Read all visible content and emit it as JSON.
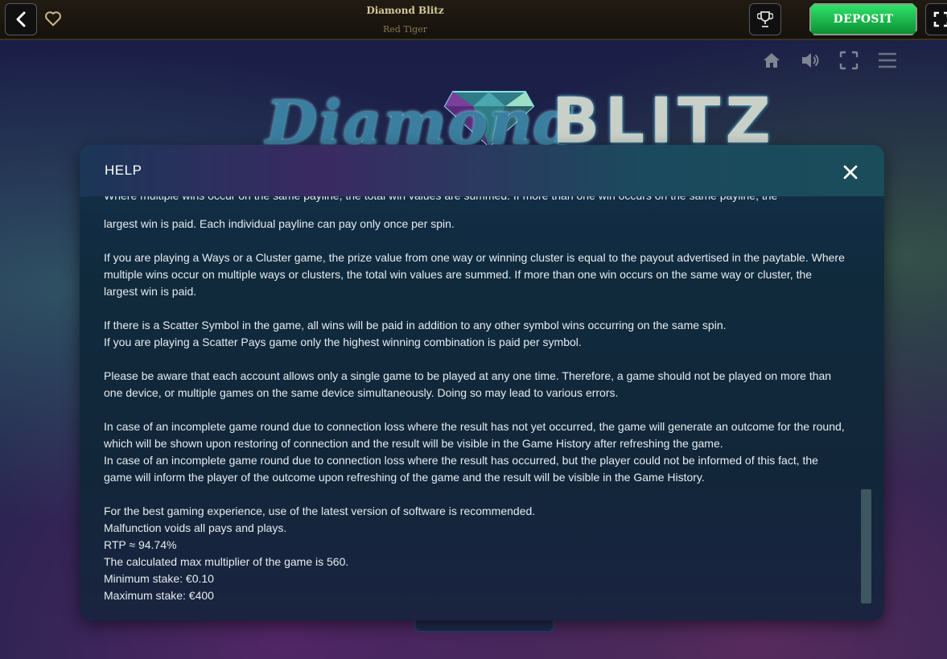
{
  "header": {
    "game_title": "Diamond Blitz",
    "provider": "Red Tiger",
    "deposit_label": "DEPOSIT"
  },
  "game": {
    "logo_left": "Diamond",
    "logo_right": "BLITZ"
  },
  "help": {
    "title": "HELP",
    "partial_line": "Where multiple wins occur on the same payline, the total win values are summed. If more than one win occurs on the same payline, the",
    "paragraphs": [
      [
        "largest win is paid. Each individual payline can pay only once per spin."
      ],
      [
        "If you are playing a Ways or a Cluster game, the prize value from one way or winning cluster is equal to the payout advertised in the paytable. Where",
        "multiple wins occur on multiple ways or clusters, the total win values are summed. If more than one win occurs on the same way or cluster, the",
        "largest win is paid."
      ],
      [
        "If there is a Scatter Symbol in the game, all wins will be paid in addition to any other symbol wins occurring on the same spin.",
        "If you are playing a Scatter Pays game only the highest winning combination is paid per symbol."
      ],
      [
        "Please be aware that each account allows only a single game to be played at any one time. Therefore, a game should not be played on more than",
        "one device, or multiple games on the same device simultaneously. Doing so may lead to various errors."
      ],
      [
        "In case of an incomplete game round due to connection loss where the result has not yet occurred, the game will generate an outcome for the round,",
        "which will be shown upon restoring of connection and the result will be visible in the Game History after refreshing the game.",
        "In case of an incomplete game round due to connection loss where the result has occurred, but the player could not be informed of this fact, the",
        "game will inform the player of the outcome upon refreshing of the game and the result will be visible in the Game History."
      ],
      [
        "For the best gaming experience, use of the latest version of software is recommended.",
        "Malfunction voids all pays and plays.",
        "RTP ≈ 94.74%",
        "The calculated max multiplier of the game is 560.",
        "Minimum stake: €0.10",
        "Maximum stake: €400"
      ]
    ]
  }
}
